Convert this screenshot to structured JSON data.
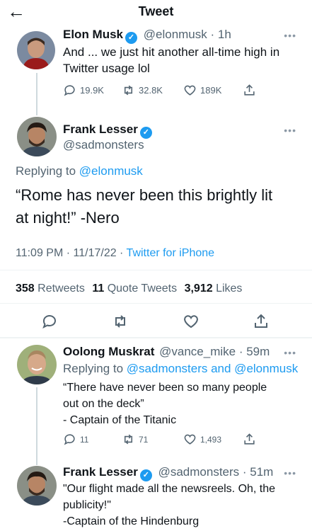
{
  "header": {
    "title": "Tweet",
    "back_icon": "arrow-left-icon"
  },
  "tweet1": {
    "name": "Elon Musk",
    "handle": "@elonmusk",
    "time": "· 1h",
    "text": [
      "And ... we just hit another all-time high in",
      "Twitter usage lol"
    ],
    "replies": "19.9K",
    "retweets": "32.8K",
    "likes": "189K"
  },
  "main": {
    "name": "Frank Lesser",
    "handle": "@sadmonsters",
    "replying_prefix": "Replying to",
    "replying_to": "@elonmusk",
    "text": [
      "“Rome has never been this brightly lit",
      "at night!” -Nero"
    ],
    "datetime": "11:09 PM · 11/17/22 ·",
    "source": "Twitter for iPhone",
    "retweets_count": "358",
    "retweets_label": "Retweets",
    "quotes_count": "11",
    "quotes_label": "Quote Tweets",
    "likes_count": "3,912",
    "likes_label": "Likes"
  },
  "reply1": {
    "name": "Oolong Muskrat",
    "handle": "@vance_mike",
    "time": "· 59m",
    "replying_prefix": "Replying to",
    "replying_to": "@sadmonsters and @elonmusk",
    "text": [
      "“There have never been so many people",
      "out on the deck”",
      "- Captain of the Titanic"
    ],
    "replies": "11",
    "retweets": "71",
    "likes": "1,493"
  },
  "reply2": {
    "name": "Frank Lesser",
    "handle": "@sadmonsters",
    "time": "· 51m",
    "text": [
      "\"Our flight made all the newsreels. Oh, the",
      "publicity!\"",
      "-Captain of the Hindenburg"
    ]
  },
  "colors": {
    "accent": "#1d9bf0",
    "text": "#0f1419",
    "secondary": "#536471"
  }
}
